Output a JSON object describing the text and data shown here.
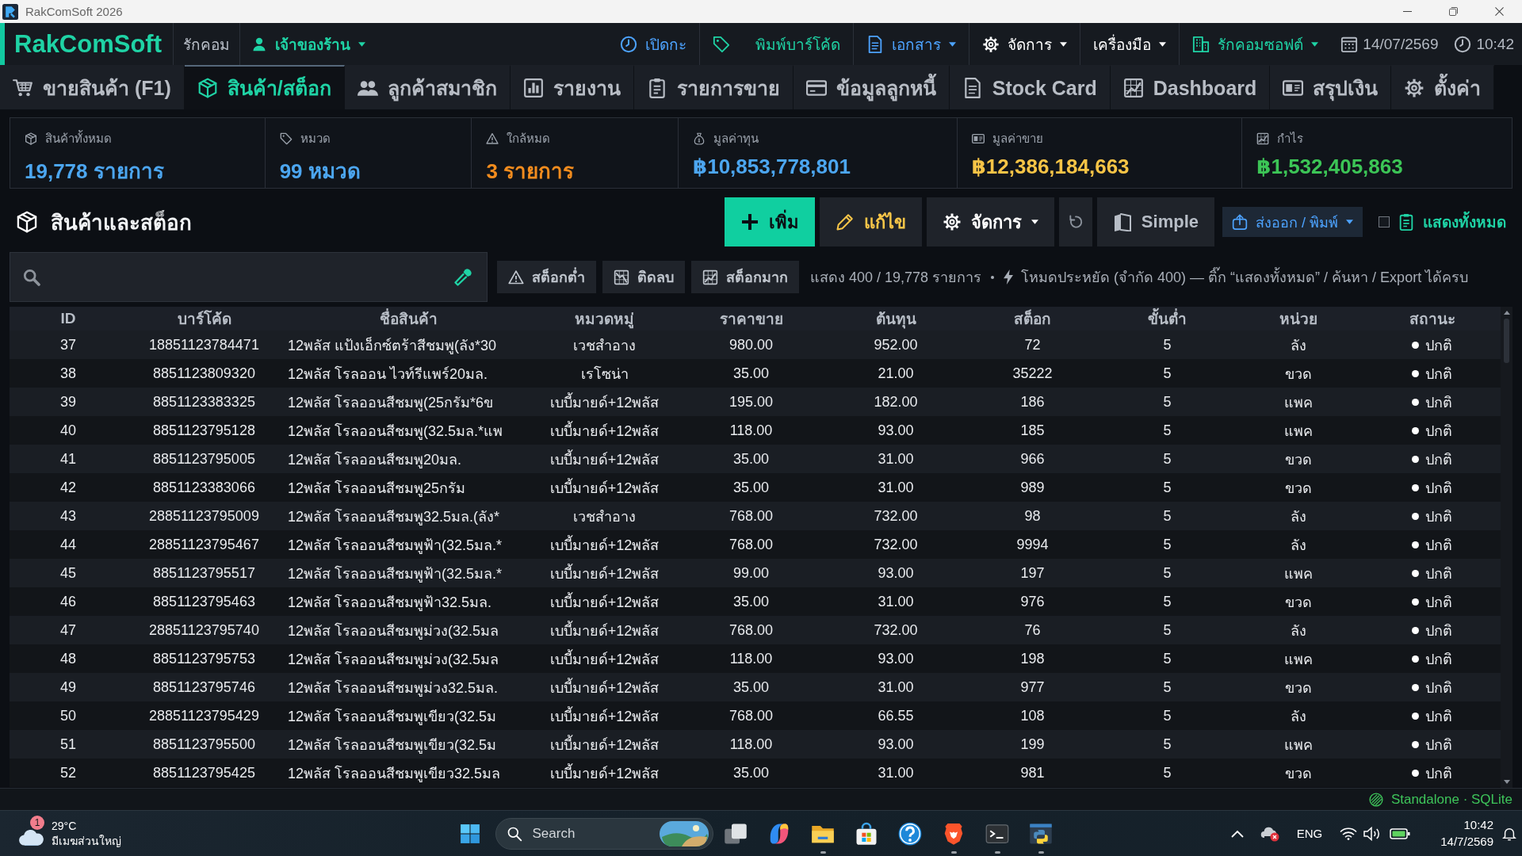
{
  "title_bar": {
    "title": "RakComSoft 2026"
  },
  "header": {
    "logo": "RakComSoft",
    "store": "รักคอม",
    "user": "เจ้าของร้าน",
    "actions": [
      {
        "label": "เปิดกะ",
        "kind": "button",
        "color": "#4da3ff"
      },
      {
        "label": "พิมพ์บาร์โค้ด",
        "kind": "button",
        "color": "#1fd3a5"
      },
      {
        "label": "เอกสาร",
        "kind": "menu",
        "color": "#4da3ff"
      },
      {
        "label": "จัดการ",
        "kind": "menu",
        "color": "#ffffff"
      },
      {
        "label": "เครื่องมือ",
        "kind": "menu",
        "color": "#ffffff"
      },
      {
        "label": "รักคอมซอฟต์",
        "kind": "menu",
        "color": "#1fd3a5"
      }
    ],
    "date": "14/07/2569",
    "time": "10:42"
  },
  "nav_tabs": [
    {
      "label": "ขายสินค้า (F1)",
      "selected": false
    },
    {
      "label": "สินค้า/สต็อก",
      "selected": true
    },
    {
      "label": "ลูกค้าสมาชิก",
      "selected": false
    },
    {
      "label": "รายงาน",
      "selected": false
    },
    {
      "label": "รายการขาย",
      "selected": false
    },
    {
      "label": "ข้อมูลลูกหนี้",
      "selected": false
    },
    {
      "label": "Stock Card",
      "selected": false
    },
    {
      "label": "Dashboard",
      "selected": false
    },
    {
      "label": "สรุปเงิน",
      "selected": false
    },
    {
      "label": "ตั้งค่า",
      "selected": false
    }
  ],
  "stats": [
    {
      "label": "สินค้าทั้งหมด",
      "value": "19,778 รายการ",
      "color": "#4ca6f0"
    },
    {
      "label": "หมวด",
      "value": "99 หมวด",
      "color": "#4ca6f0"
    },
    {
      "label": "ใกล้หมด",
      "value": "3 รายการ",
      "color": "#f28c1e"
    },
    {
      "label": "มูลค่าทุน",
      "value": "฿10,853,778,801",
      "color": "#4ca6f0"
    },
    {
      "label": "มูลค่าขาย",
      "value": "฿12,386,184,663",
      "color": "#f7c446"
    },
    {
      "label": "กำไร",
      "value": "฿1,532,405,863",
      "color": "#3cc556"
    }
  ],
  "products": {
    "title": "สินค้าและสต็อก",
    "buttons": [
      {
        "label": "เพิ่ม",
        "kind": "add"
      },
      {
        "label": "แก้ไข",
        "kind": "edit"
      },
      {
        "label": "จัดการ",
        "kind": "menu"
      },
      {
        "kind": "refresh"
      },
      {
        "label": "Simple",
        "kind": "mode"
      },
      {
        "label": "ส่งออก / พิมพ์",
        "kind": "export"
      }
    ],
    "show_all": {
      "label": "แสดงทั้งหมด",
      "checked": false
    },
    "filters": [
      "สต็อกต่ำ",
      "ติดลบ",
      "สต็อกมาก"
    ],
    "count": "แสดง 400 / 19,778 รายการ",
    "notice": "โหมดประหยัด (จำกัด 400) — ติ๊ก “แสดงทั้งหมด” / ค้นหา / Export ได้ครบ"
  },
  "table": {
    "columns": [
      "ID",
      "บาร์โค้ด",
      "ชื่อสินค้า",
      "หมวดหมู่",
      "ราคาขาย",
      "ต้นทุน",
      "สต็อก",
      "ขั้นต่ำ",
      "หน่วย",
      "สถานะ"
    ],
    "rows": [
      [
        "37",
        "18851123784471",
        "12พลัส แป้งเอ็กซ์ตร้าสีชมพู(ลัง*30",
        "เวชสำอาง",
        "980.00",
        "952.00",
        "72",
        "5",
        "ลัง",
        "ปกติ"
      ],
      [
        "38",
        "8851123809320",
        "12พลัส โรลออน ไวท์รีแพร์20มล.",
        "เรโซน่า",
        "35.00",
        "21.00",
        "35222",
        "5",
        "ขวด",
        "ปกติ"
      ],
      [
        "39",
        "8851123383325",
        "12พลัส โรลออนสีชมพู(25กรัม*6ข",
        "เบบี้มายด์+12พลัส",
        "195.00",
        "182.00",
        "186",
        "5",
        "แพค",
        "ปกติ"
      ],
      [
        "40",
        "8851123795128",
        "12พลัส โรลออนสีชมพู(32.5มล.*แพ",
        "เบบี้มายด์+12พลัส",
        "118.00",
        "93.00",
        "185",
        "5",
        "แพค",
        "ปกติ"
      ],
      [
        "41",
        "8851123795005",
        "12พลัส โรลออนสีชมพู20มล.",
        "เบบี้มายด์+12พลัส",
        "35.00",
        "31.00",
        "966",
        "5",
        "ขวด",
        "ปกติ"
      ],
      [
        "42",
        "8851123383066",
        "12พลัส โรลออนสีชมพู25กรัม",
        "เบบี้มายด์+12พลัส",
        "35.00",
        "31.00",
        "989",
        "5",
        "ขวด",
        "ปกติ"
      ],
      [
        "43",
        "28851123795009",
        "12พลัส โรลออนสีชมพู32.5มล.(ลัง*",
        "เวชสำอาง",
        "768.00",
        "732.00",
        "98",
        "5",
        "ลัง",
        "ปกติ"
      ],
      [
        "44",
        "28851123795467",
        "12พลัส โรลออนสีชมพูฟ้า(32.5มล.*",
        "เบบี้มายด์+12พลัส",
        "768.00",
        "732.00",
        "9994",
        "5",
        "ลัง",
        "ปกติ"
      ],
      [
        "45",
        "8851123795517",
        "12พลัส โรลออนสีชมพูฟ้า(32.5มล.*",
        "เบบี้มายด์+12พลัส",
        "99.00",
        "93.00",
        "197",
        "5",
        "แพค",
        "ปกติ"
      ],
      [
        "46",
        "8851123795463",
        "12พลัส โรลออนสีชมพูฟ้า32.5มล.",
        "เบบี้มายด์+12พลัส",
        "35.00",
        "31.00",
        "976",
        "5",
        "ขวด",
        "ปกติ"
      ],
      [
        "47",
        "28851123795740",
        "12พลัส โรลออนสีชมพูม่วง(32.5มล",
        "เบบี้มายด์+12พลัส",
        "768.00",
        "732.00",
        "76",
        "5",
        "ลัง",
        "ปกติ"
      ],
      [
        "48",
        "8851123795753",
        "12พลัส โรลออนสีชมพูม่วง(32.5มล",
        "เบบี้มายด์+12พลัส",
        "118.00",
        "93.00",
        "198",
        "5",
        "แพค",
        "ปกติ"
      ],
      [
        "49",
        "8851123795746",
        "12พลัส โรลออนสีชมพูม่วง32.5มล.",
        "เบบี้มายด์+12พลัส",
        "35.00",
        "31.00",
        "977",
        "5",
        "ขวด",
        "ปกติ"
      ],
      [
        "50",
        "28851123795429",
        "12พลัส โรลออนสีชมพูเขียว(32.5ม",
        "เบบี้มายด์+12พลัส",
        "768.00",
        "66.55",
        "108",
        "5",
        "ลัง",
        "ปกติ"
      ],
      [
        "51",
        "8851123795500",
        "12พลัส โรลออนสีชมพูเขียว(32.5ม",
        "เบบี้มายด์+12พลัส",
        "118.00",
        "93.00",
        "199",
        "5",
        "แพค",
        "ปกติ"
      ],
      [
        "52",
        "8851123795425",
        "12พลัส โรลออนสีชมพูเขียว32.5มล",
        "เบบี้มายด์+12พลัส",
        "35.00",
        "31.00",
        "981",
        "5",
        "ขวด",
        "ปกติ"
      ]
    ]
  },
  "status_bar": {
    "text": "Standalone · SQLite"
  },
  "taskbar": {
    "weather": {
      "badge": "1",
      "temperature": "29°C",
      "condition": "มีเมฆส่วนใหญ่"
    },
    "search": {
      "placeholder": "Search"
    },
    "apps": [
      {
        "running": false
      },
      {
        "running": false
      },
      {
        "running": true
      },
      {
        "running": false
      },
      {
        "running": false
      },
      {
        "running": true
      },
      {
        "running": true
      },
      {
        "running": true
      }
    ],
    "language": "ENG",
    "time": "10:42",
    "date": "14/7/2569"
  }
}
